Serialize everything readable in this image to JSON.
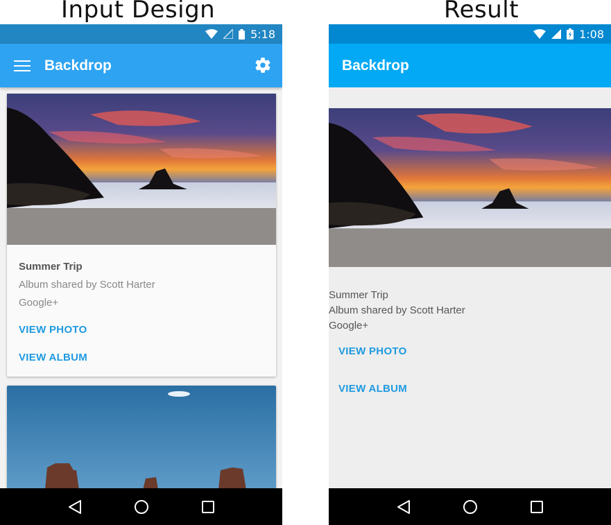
{
  "captions": {
    "left": "Input Design",
    "right": "Result"
  },
  "left": {
    "status_time": "5:18",
    "app_title": "Backdrop",
    "card": {
      "title": "Summer Trip",
      "subtitle": "Album shared by Scott Harter",
      "source": "Google+",
      "action_photo": "VIEW PHOTO",
      "action_album": "VIEW ALBUM"
    }
  },
  "right": {
    "status_time": "1:08",
    "app_title": "Backdrop",
    "card": {
      "title": "Summer Trip",
      "subtitle": "Album shared by Scott Harter",
      "source": "Google+",
      "action_photo": "VIEW PHOTO",
      "action_album": "VIEW ALBUM"
    }
  },
  "icons": {
    "menu": "menu-icon",
    "settings": "gear-icon",
    "back": "back-icon",
    "home": "home-icon",
    "recents": "recents-icon",
    "wifi": "wifi-icon",
    "signal": "signal-icon",
    "battery": "battery-icon"
  },
  "colors": {
    "app_bar_left": "#2ea3f2",
    "app_bar_right": "#03a9f4",
    "accent": "#1e9ae0"
  }
}
